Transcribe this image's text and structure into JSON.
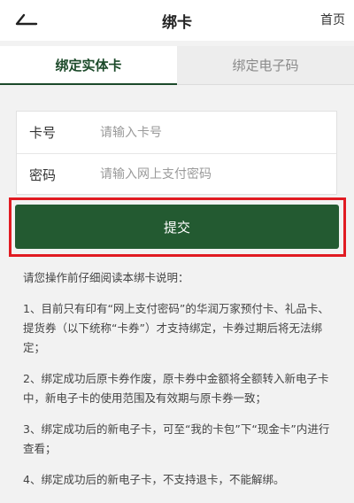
{
  "header": {
    "title": "绑卡",
    "home_label": "首页"
  },
  "tabs": [
    {
      "label": "绑定实体卡",
      "active": true
    },
    {
      "label": "绑定电子码",
      "active": false
    }
  ],
  "form": {
    "card_number": {
      "label": "卡号",
      "placeholder": "请输入卡号",
      "value": ""
    },
    "password": {
      "label": "密码",
      "placeholder": "请输入网上支付密码",
      "value": ""
    }
  },
  "submit_label": "提交",
  "notes": {
    "intro": "请您操作前仔细阅读本绑卡说明：",
    "items": [
      "1、目前只有印有“网上支付密码”的华润万家预付卡、礼品卡、提货券（以下统称“卡券”）才支持绑定，卡券过期后将无法绑定；",
      "2、绑定成功后原卡券作废，原卡券中金额将全额转入新电子卡中，新电子卡的使用范围及有效期与原卡券一致；",
      "3、绑定成功后的新电子卡，可至“我的卡包”下“现金卡”内进行查看；",
      "4、绑定成功后的新电子卡，不支持退卡，不能解绑。"
    ]
  },
  "colors": {
    "accent": "#235a31",
    "highlight": "#e11b22"
  }
}
